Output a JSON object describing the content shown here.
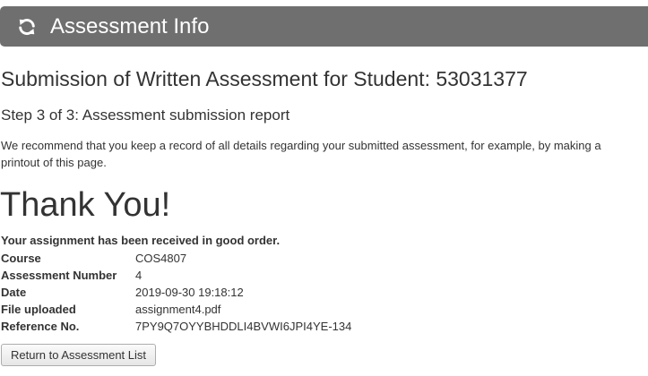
{
  "header": {
    "title": "Assessment Info",
    "icon": "refresh-icon",
    "background_color": "#6f6f6f"
  },
  "page": {
    "title": "Submission of Written Assessment for Student: 53031377",
    "step": "Step 3 of 3: Assessment submission report",
    "intro": "We recommend that you keep a record of all details regarding your submitted assessment, for example, by making a printout of this page.",
    "thanks": "Thank You!",
    "received": "Your assignment has been received in good order."
  },
  "details": [
    {
      "label": "Course",
      "value": "COS4807"
    },
    {
      "label": "Assessment Number",
      "value": "4"
    },
    {
      "label": "Date",
      "value": "2019-09-30 19:18:12"
    },
    {
      "label": "File uploaded",
      "value": "assignment4.pdf"
    },
    {
      "label": "Reference No.",
      "value": "7PY9Q7OYYBHDDLI4BVWI6JPI4YE-134"
    }
  ],
  "actions": {
    "return_label": "Return to Assessment List"
  }
}
